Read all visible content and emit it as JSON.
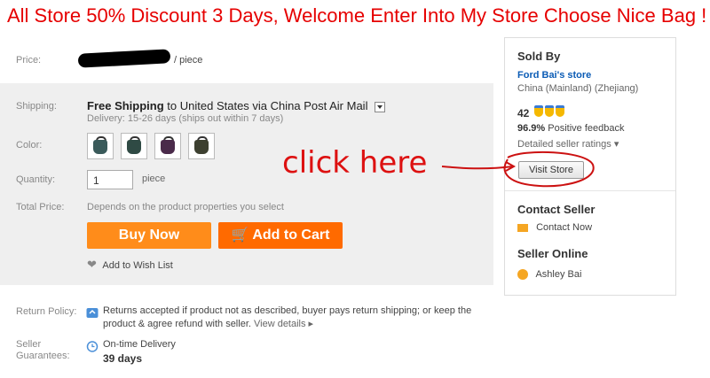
{
  "banner": "All Store 50% Discount 3 Days, Welcome Enter Into My Store Choose Nice Bag !",
  "price": {
    "label": "Price:",
    "unit": "/ piece"
  },
  "shipping": {
    "label": "Shipping:",
    "free": "Free Shipping",
    "to": "to United States via China Post Air Mail",
    "delivery": "Delivery: 15-26 days (ships out within 7 days)"
  },
  "color": {
    "label": "Color:",
    "swatches": [
      "#3a5a5a",
      "#2f4a44",
      "#4a2a4a",
      "#3d4030"
    ]
  },
  "quantity": {
    "label": "Quantity:",
    "value": "1",
    "unit": "piece"
  },
  "total": {
    "label": "Total Price:",
    "value": "Depends on the product properties you select"
  },
  "actions": {
    "buy_now": "Buy Now",
    "add_to_cart": "Add to Cart",
    "wish_list": "Add to Wish List"
  },
  "return_policy": {
    "label": "Return Policy:",
    "text": "Returns accepted if product not as described, buyer pays return shipping; or keep the product & agree refund with seller.",
    "link": "View details ▸"
  },
  "guarantees": {
    "label": "Seller Guarantees:",
    "text": "On-time Delivery",
    "days": "39 days"
  },
  "seller": {
    "sold_by": "Sold By",
    "store": "Ford Bai's store",
    "location": "China (Mainland) (Zhejiang)",
    "score": "42",
    "feedback_pct": "96.9%",
    "feedback_text": "Positive feedback",
    "ratings": "Detailed seller ratings ▾",
    "visit_store": "Visit Store",
    "contact_heading": "Contact Seller",
    "contact_now": "Contact Now",
    "online_heading": "Seller Online",
    "online_name": "Ashley Bai"
  },
  "annotation": "click here"
}
